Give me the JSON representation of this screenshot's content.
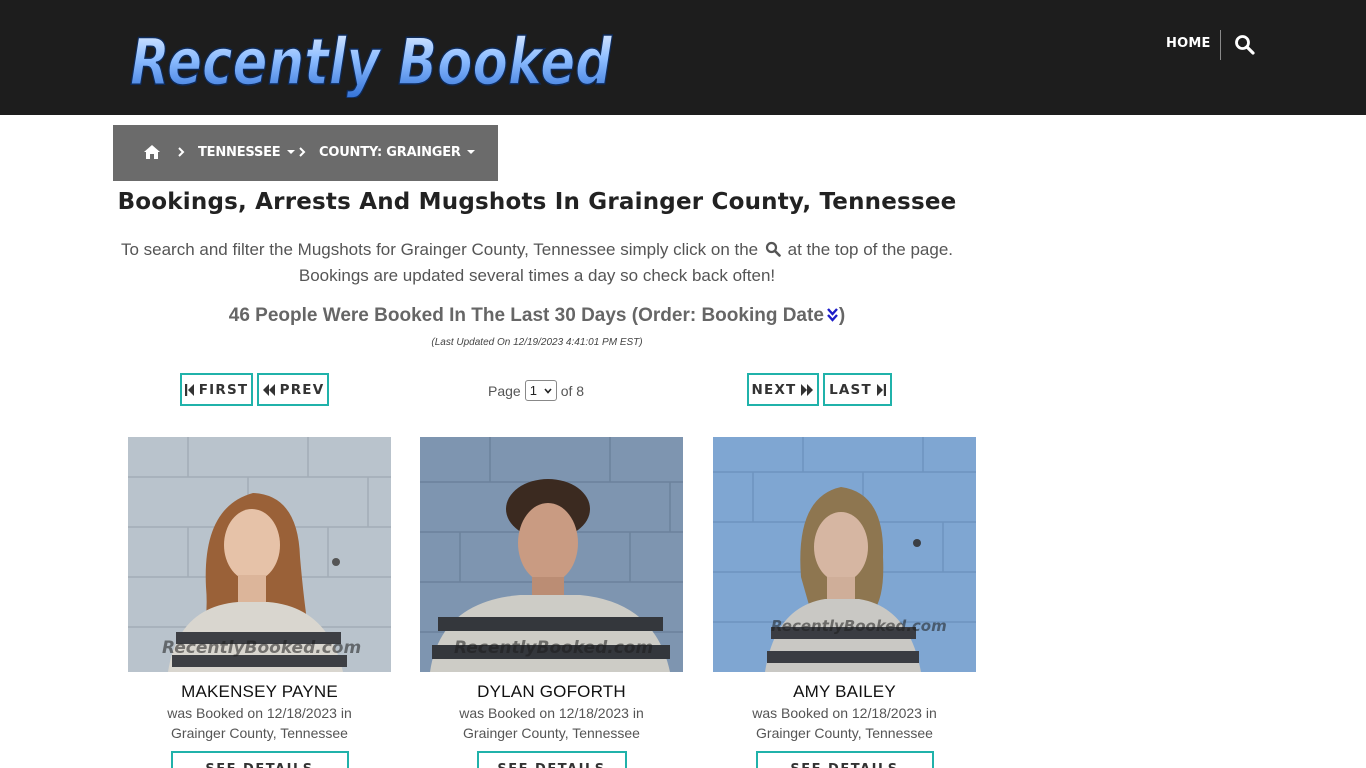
{
  "header": {
    "logo_text": "Recently Booked",
    "nav_home": "HOME",
    "search_icon": "search-icon",
    "brand_colors": {
      "background": "#1d1d1d",
      "logo_blue": "#5ea2ff",
      "accent": "#20b2aa"
    }
  },
  "breadcrumb": {
    "home_icon": "home-icon",
    "state": "TENNESSEE",
    "county": "COUNTY: GRAINGER"
  },
  "main": {
    "title": "Bookings, Arrests And Mugshots In Grainger County, Tennessee",
    "intro_before_icon": "To search and filter the Mugshots for Grainger County, Tennessee simply click on the",
    "intro_after_icon": "at the top of the page.",
    "intro_line2": "Bookings are updated several times a day so check back often!",
    "count_text": "46 People Were Booked In The Last 30 Days (Order: Booking Date",
    "count_close": ")",
    "updated": "(Last Updated On 12/19/2023 4:41:01 PM EST)"
  },
  "pager": {
    "first": "FIRST",
    "prev": "PREV",
    "next": "NEXT",
    "last": "LAST",
    "page_label": "Page",
    "current_page": "1",
    "of_label": "of 8"
  },
  "cards": [
    {
      "name": "MAKENSEY PAYNE",
      "booked_line": "was Booked on 12/18/2023 in",
      "location": "Grainger County, Tennessee",
      "button": "SEE DETAILS",
      "watermark": "RecentlyBooked.com"
    },
    {
      "name": "DYLAN GOFORTH",
      "booked_line": "was Booked on 12/18/2023 in",
      "location": "Grainger County, Tennessee",
      "button": "SEE DETAILS",
      "watermark": "RecentlyBooked.com"
    },
    {
      "name": "AMY BAILEY",
      "booked_line": "was Booked on 12/18/2023 in",
      "location": "Grainger County, Tennessee",
      "button": "SEE DETAILS",
      "watermark": "RecentlyBooked.com"
    }
  ]
}
